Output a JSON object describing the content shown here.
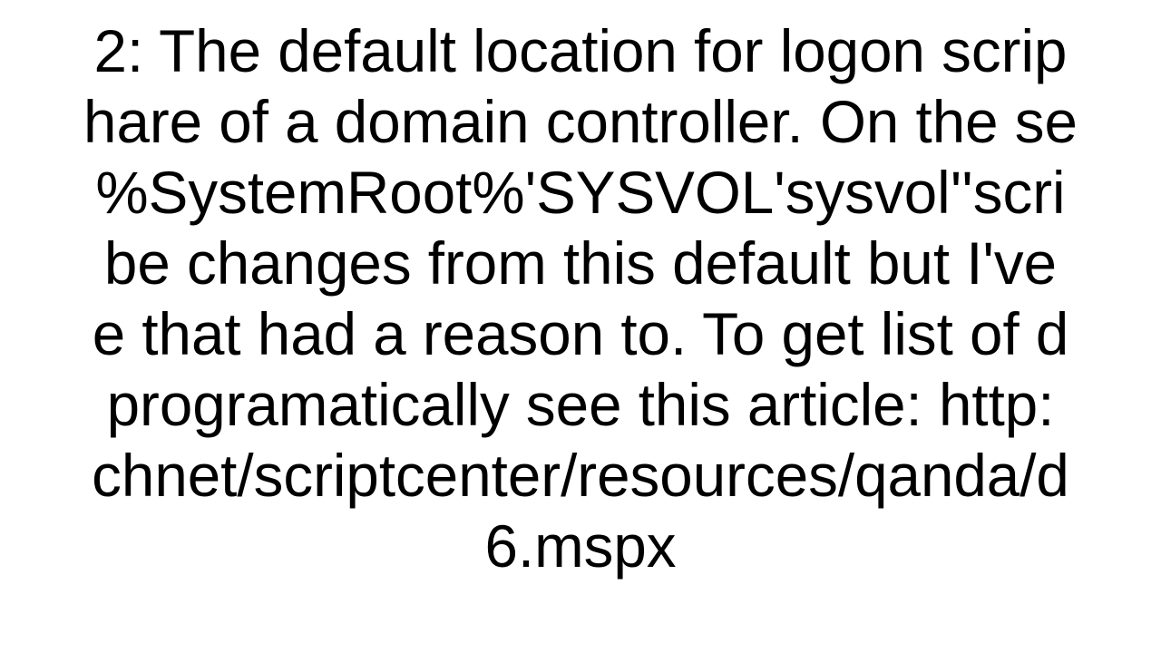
{
  "paragraph": {
    "line1": "2: The default location for logon scrip",
    "line2": "hare of a domain controller. On the se",
    "line3": "%SystemRoot%'SYSVOL'sysvol''scri",
    "line4": "be changes from this default but I've",
    "line5": "e that had a reason to. To get list of d",
    "line6": "programatically see this article: http:",
    "line7": "chnet/scriptcenter/resources/qanda/d",
    "line8": "6.mspx"
  }
}
